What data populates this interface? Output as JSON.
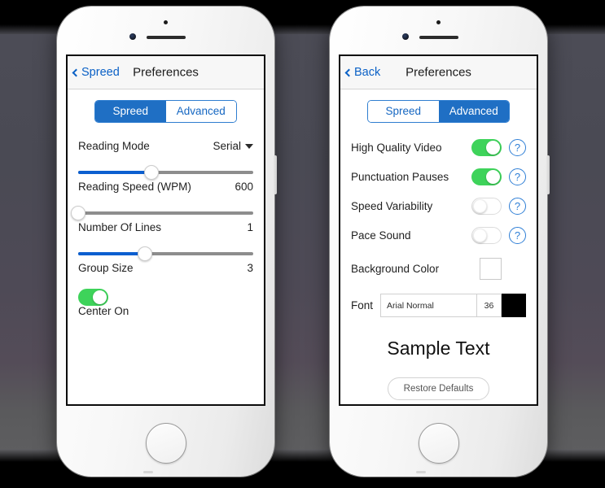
{
  "phones": {
    "left": {
      "nav": {
        "back_label": "Spreed",
        "title": "Preferences"
      },
      "segmented": {
        "options": [
          "Spreed",
          "Advanced"
        ],
        "selected": "Spreed"
      },
      "reading_mode": {
        "label": "Reading Mode",
        "value": "Serial"
      },
      "sliders": [
        {
          "label": "Reading Speed (WPM)",
          "value": "600",
          "percent": 42
        },
        {
          "label": "Number Of Lines",
          "value": "1",
          "percent": 0
        },
        {
          "label": "Group Size",
          "value": "3",
          "percent": 38
        }
      ],
      "center": {
        "label": "Center On",
        "state": "on"
      }
    },
    "right": {
      "nav": {
        "back_label": "Back",
        "title": "Preferences"
      },
      "segmented": {
        "options": [
          "Spreed",
          "Advanced"
        ],
        "selected": "Advanced"
      },
      "switches": [
        {
          "label": "High Quality Video",
          "state": "on",
          "help": "?"
        },
        {
          "label": "Punctuation Pauses",
          "state": "on",
          "help": "?"
        },
        {
          "label": "Speed Variability",
          "state": "off",
          "help": "?"
        },
        {
          "label": "Pace Sound",
          "state": "off",
          "help": "?"
        }
      ],
      "background_color": {
        "label": "Background Color",
        "swatch_hex": "#ffffff"
      },
      "font": {
        "label": "Font",
        "name": "Arial Normal",
        "size": "36",
        "color_hex": "#000000"
      },
      "sample_text": "Sample Text",
      "restore_button": "Restore Defaults"
    }
  },
  "colors": {
    "accent_blue": "#1f6fc4",
    "link_blue": "#0b61c6",
    "slider_blue": "#0b5fd0",
    "toggle_green": "#3ed35a",
    "track_gray": "#8d8d8d",
    "help_blue": "#2f7fd6"
  }
}
